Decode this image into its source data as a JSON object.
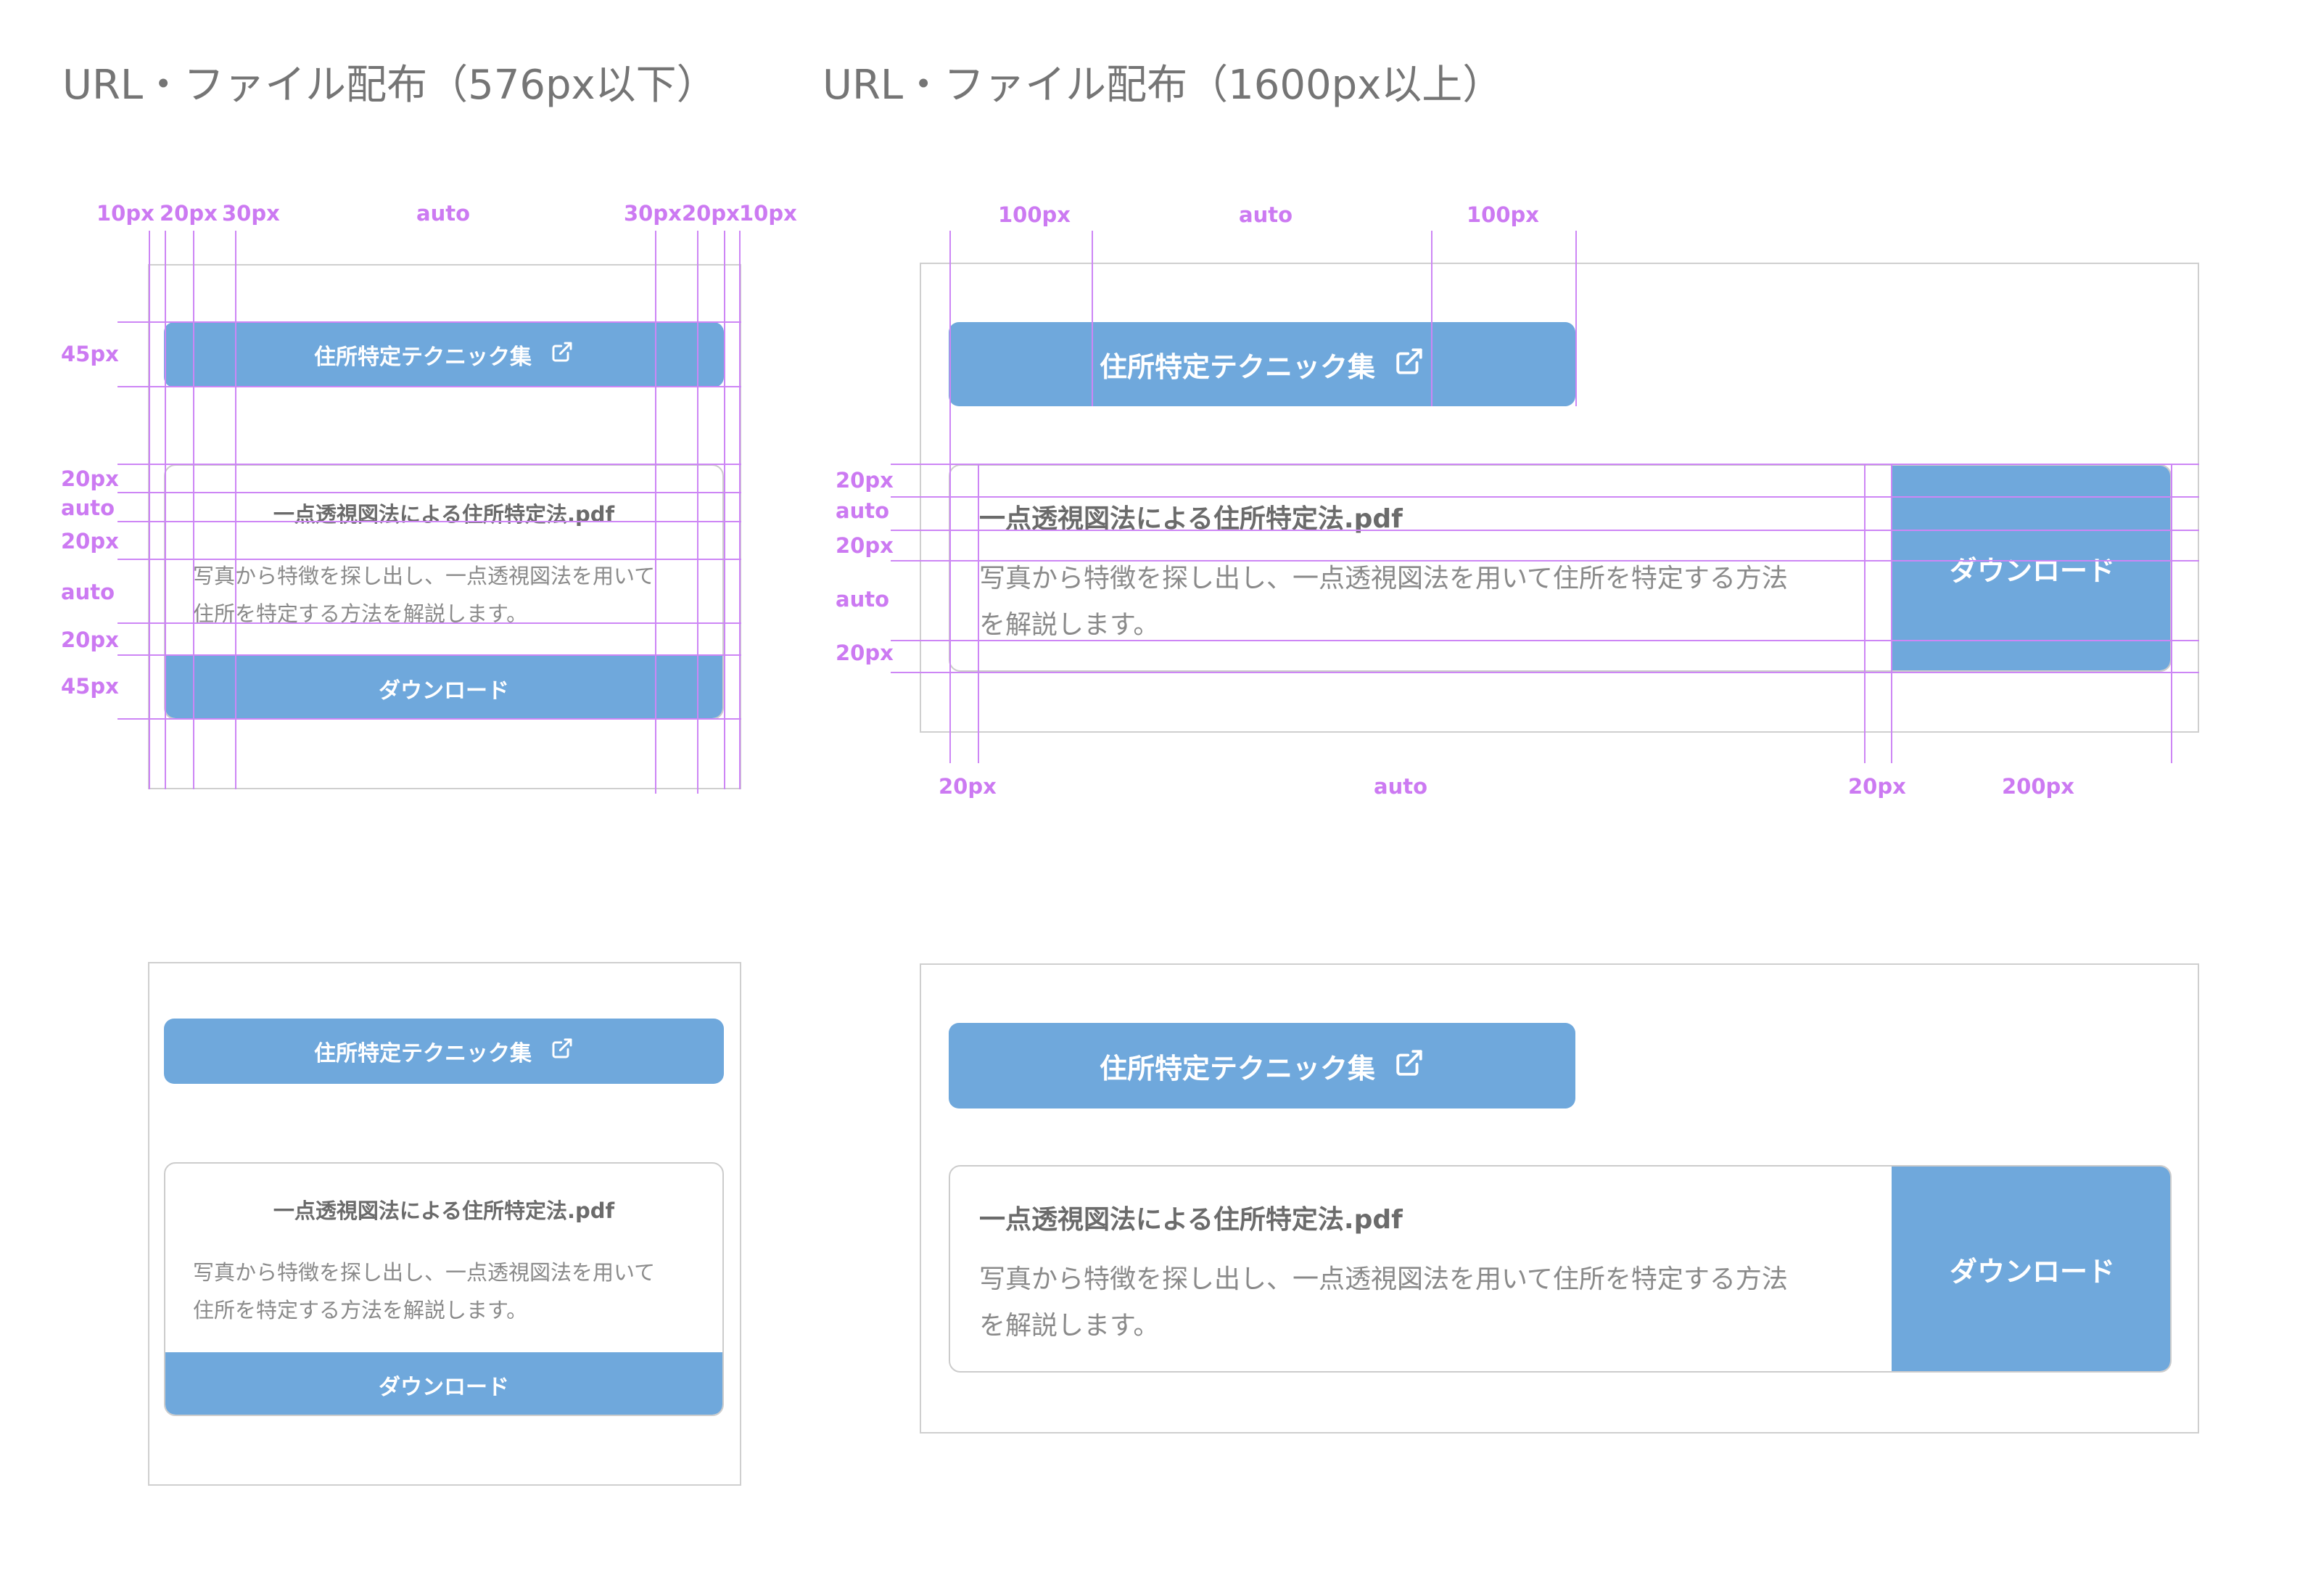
{
  "headings": {
    "small": "URL・ファイル配布（576px以下）",
    "large": "URL・ファイル配布（1600px以上）"
  },
  "component": {
    "link_button_label": "住所特定テクニック集",
    "link_icon": "external-link-icon",
    "file_name": "一点透視図法による住所特定法.pdf",
    "description": "写真から特徴を探し出し、一点透視図法を用いて住所を特定する方法を解説します。",
    "description_small_line1": "写真から特徴を探し出し、一点透視図法を用いて",
    "description_small_line2": "住所を特定する方法を解説します。",
    "description_large_line1": "写真から特徴を探し出し、一点透視図法を用いて住所を特定する方法",
    "description_large_line2": "を解説します。",
    "download_label": "ダウンロード"
  },
  "annotations": {
    "small_top": [
      "10px",
      "20px",
      "30px",
      "auto",
      "30px",
      "20px",
      "10px"
    ],
    "small_left": [
      "45px",
      "20px",
      "auto",
      "20px",
      "auto",
      "20px",
      "45px"
    ],
    "large_top": [
      "100px",
      "auto",
      "100px"
    ],
    "large_left": [
      "20px",
      "auto",
      "20px",
      "auto",
      "20px"
    ],
    "large_bottom": [
      "20px",
      "auto",
      "20px",
      "200px"
    ]
  },
  "colors": {
    "accent": "#6fa8dc",
    "annotation": "#cc7af2",
    "heading_text": "#757575",
    "frame_border": "#cfcfcf"
  }
}
